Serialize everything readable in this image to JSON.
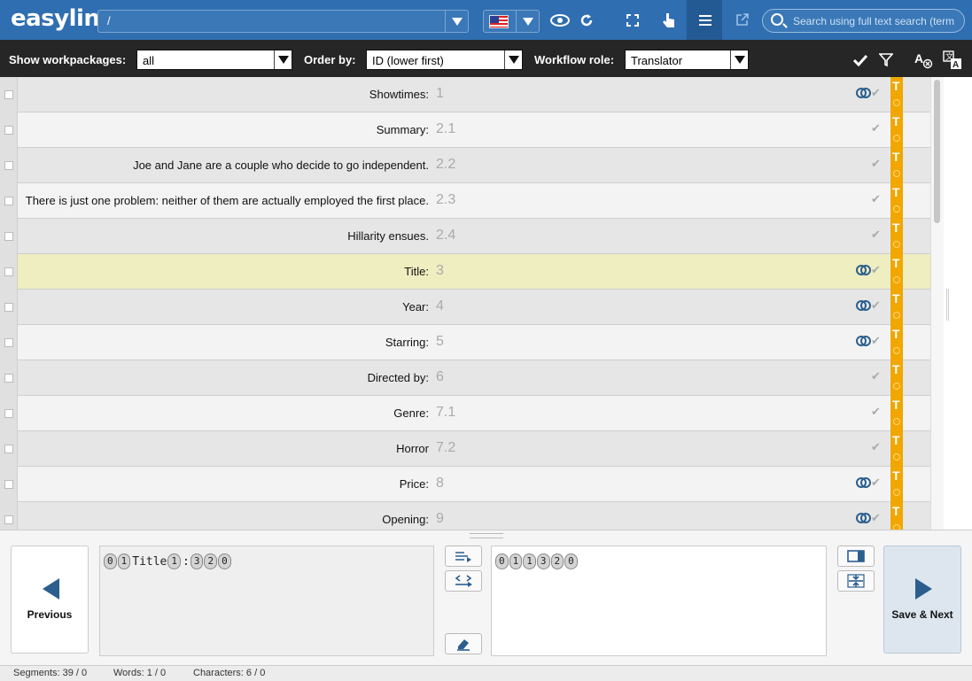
{
  "header": {
    "logo": "easyling",
    "path_value": "/",
    "search_placeholder": "Search using full text search (term"
  },
  "filters": {
    "workpackages_label": "Show workpackages:",
    "workpackages_value": "all",
    "order_label": "Order by:",
    "order_value": "ID (lower first)",
    "workflow_label": "Workflow role:",
    "workflow_value": "Translator"
  },
  "segments": [
    {
      "text": "Showtimes:",
      "num": "1",
      "linked": true
    },
    {
      "text": "Summary:",
      "num": "2.1",
      "linked": false
    },
    {
      "text": "Joe and Jane are a couple who decide to go independent.",
      "num": "2.2",
      "linked": false
    },
    {
      "text": "There is just one problem: neither of them are actually employed the first place.",
      "num": "2.3",
      "linked": false
    },
    {
      "text": "Hillarity ensues.",
      "num": "2.4",
      "linked": false
    },
    {
      "text": "Title:",
      "num": "3",
      "linked": true
    },
    {
      "text": "Year:",
      "num": "4",
      "linked": true
    },
    {
      "text": "Starring:",
      "num": "5",
      "linked": true
    },
    {
      "text": "Directed by:",
      "num": "6",
      "linked": false
    },
    {
      "text": "Genre:",
      "num": "7.1",
      "linked": false
    },
    {
      "text": "Horror",
      "num": "7.2",
      "linked": false
    },
    {
      "text": "Price:",
      "num": "8",
      "linked": true
    },
    {
      "text": "Opening:",
      "num": "9",
      "linked": true
    }
  ],
  "segment_status_letter": "T",
  "editor": {
    "prev_label": "Previous",
    "next_label": "Save & Next",
    "source": {
      "t0": "0",
      "t1": "1",
      "text": "Title",
      "t2": "1",
      "colon": ":",
      "t3": "3",
      "t4": "2",
      "t5": "0"
    },
    "target": {
      "t0": "0",
      "t1": "1",
      "t2": "1",
      "t3": "3",
      "t4": "2",
      "t5": "0"
    }
  },
  "status": {
    "segments": "Segments: 39 / 0",
    "words": "Words: 1 / 0",
    "characters": "Characters: 6 / 0"
  },
  "colors": {
    "topbar": "#2f6eb0",
    "filterbar": "#262626",
    "status_strip": "#f1a600",
    "selected_row": "#eeeec0",
    "accent": "#2b5e8e"
  }
}
